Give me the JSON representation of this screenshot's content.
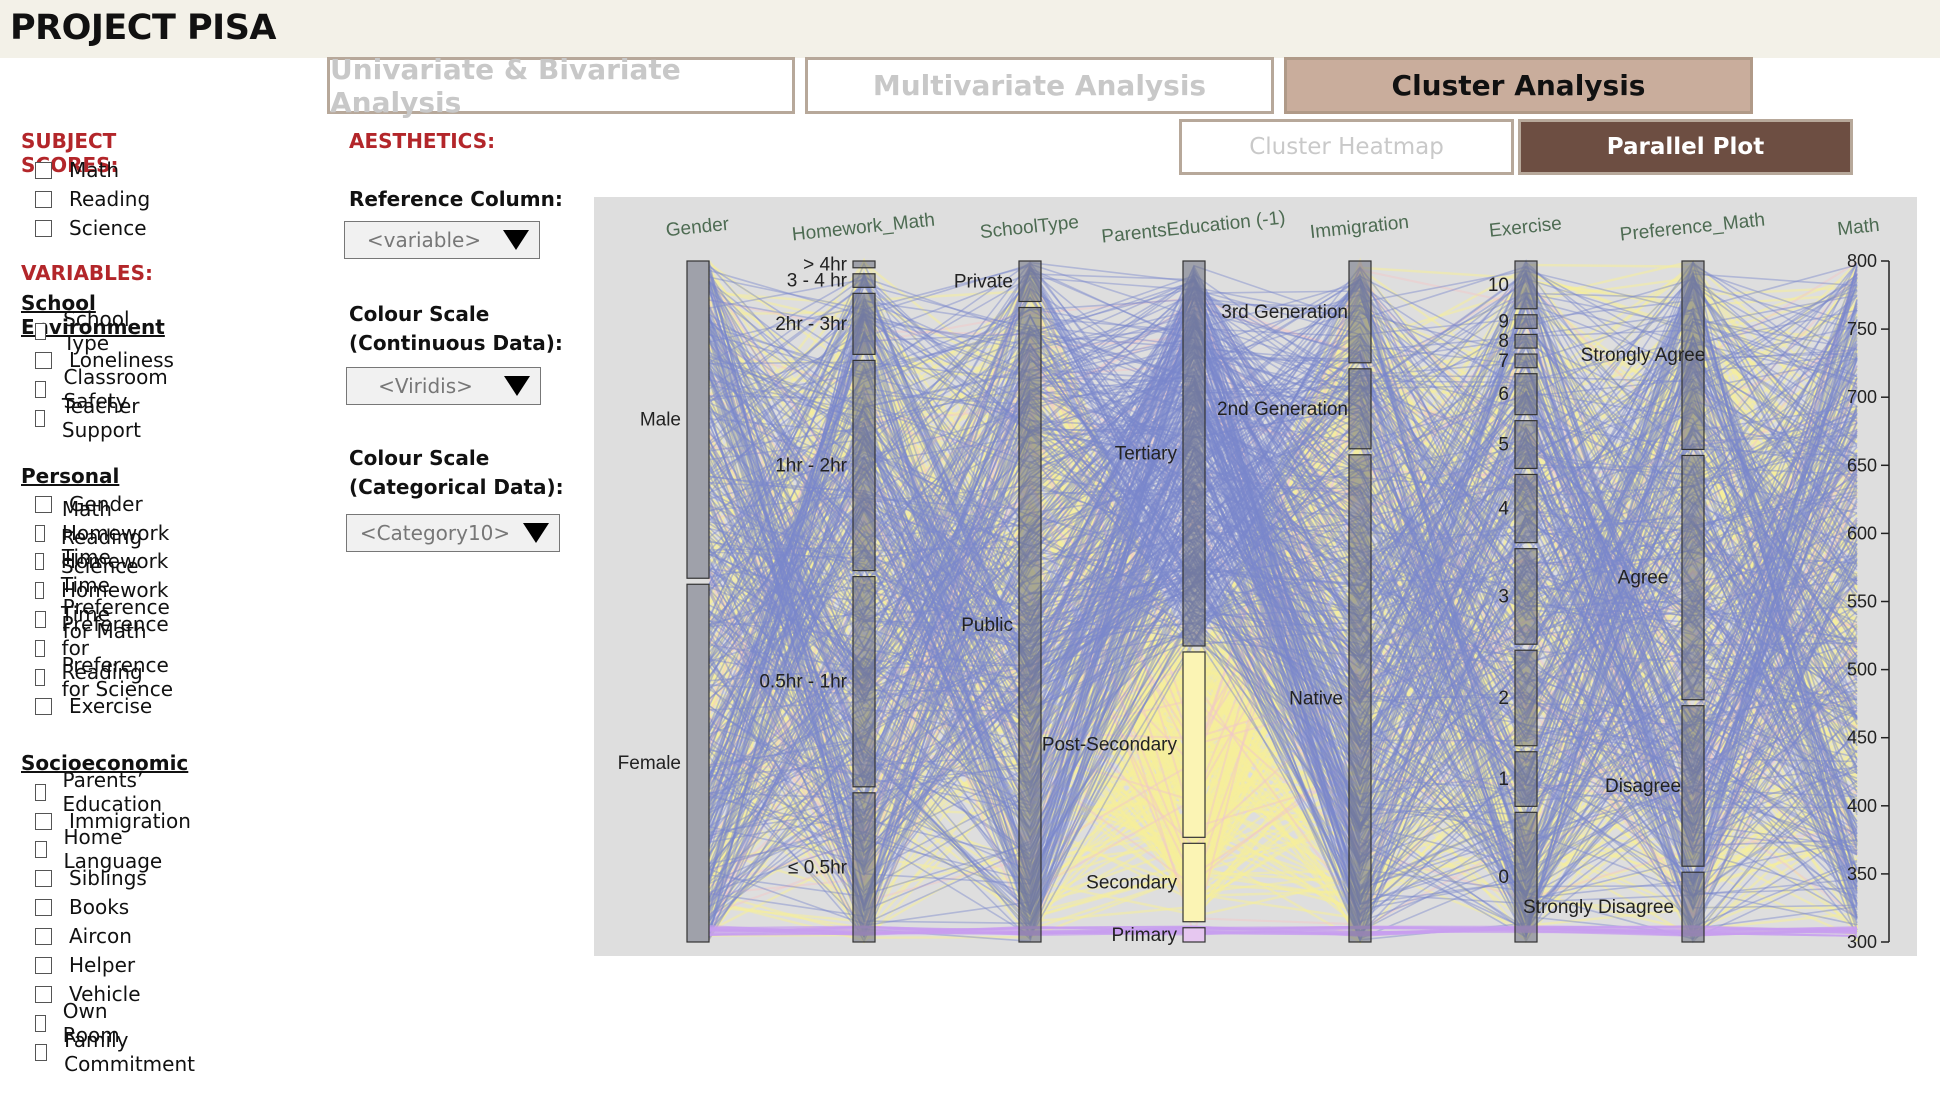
{
  "app": {
    "title": "PROJECT PISA"
  },
  "tabs": [
    {
      "label": "Univariate & Bivariate Analysis",
      "active": false
    },
    {
      "label": "Multivariate Analysis",
      "active": false
    },
    {
      "label": "Cluster Analysis",
      "active": true
    }
  ],
  "subtabs": [
    {
      "label": "Cluster Heatmap",
      "active": false
    },
    {
      "label": "Parallel Plot",
      "active": true
    }
  ],
  "sidebar": {
    "subject_scores_title": "SUBJECT SCORES:",
    "subject_scores": [
      "Math",
      "Reading",
      "Science"
    ],
    "variables_title": "VARIABLES:",
    "groups": [
      {
        "title": "School Environment",
        "items": [
          "School Type",
          "Loneliness",
          "Classroom Safety",
          "Teacher Support"
        ]
      },
      {
        "title": "Personal",
        "items": [
          "Gender",
          "Math Homework Time",
          "Reading Homework Time",
          "Science Homework Time",
          "Preference for Math",
          "Preference for Reading",
          "Preference for Science",
          "Exercise"
        ]
      },
      {
        "title": "Socioeconomic",
        "items": [
          "Parents’ Education",
          "Immigration",
          "Home Language",
          "Siblings",
          "Books",
          "Aircon",
          "Helper",
          "Vehicle",
          "Own Room",
          "Family Commitment"
        ]
      }
    ]
  },
  "aesthetics": {
    "title": "AESTHETICS:",
    "reference_label": "Reference Column:",
    "reference_value": "<variable>",
    "continuous_label_1": "Colour Scale",
    "continuous_label_2": "(Continuous Data):",
    "continuous_value": "<Viridis>",
    "categorical_label_1": "Colour Scale",
    "categorical_label_2": "(Categorical Data):",
    "categorical_value": "<Category10>"
  },
  "colors": {
    "blue_cluster": "#7b88cc",
    "yellow_cluster": "#f6ef9a",
    "pink_cluster": "#f2c7c7",
    "purple_cluster": "#c89ef0",
    "accent_red": "#b3262a",
    "tab_active": "#c9ad9c",
    "subtab_active": "#6d4e42"
  },
  "chart_data": {
    "type": "parallel-categories",
    "axes": [
      {
        "name": "Gender",
        "categories": [
          {
            "label": "Male",
            "share": 0.47
          },
          {
            "label": "Female",
            "share": 0.53
          }
        ]
      },
      {
        "name": "Homework_Math",
        "categories": [
          {
            "label": "> 4hr",
            "share": 0.01
          },
          {
            "label": "3 - 4 hr",
            "share": 0.02
          },
          {
            "label": "2hr - 3hr",
            "share": 0.09
          },
          {
            "label": "1hr - 2hr",
            "share": 0.31
          },
          {
            "label": "0.5hr - 1hr",
            "share": 0.31
          },
          {
            "label": "≤ 0.5hr",
            "share": 0.22
          }
        ]
      },
      {
        "name": "SchoolType",
        "categories": [
          {
            "label": "Private",
            "share": 0.06
          },
          {
            "label": "Public",
            "share": 0.94
          }
        ]
      },
      {
        "name": "ParentsEducation (-1)",
        "categories": [
          {
            "label": "Tertiary",
            "share": 0.54
          },
          {
            "label": "Post-Secondary",
            "share": 0.26
          },
          {
            "label": "Secondary",
            "share": 0.11
          },
          {
            "label": "Primary",
            "share": 0.02
          }
        ]
      },
      {
        "name": "Immigration",
        "categories": [
          {
            "label": "3rd Generation",
            "share": 0.14
          },
          {
            "label": "2nd Generation",
            "share": 0.11
          },
          {
            "label": "Native",
            "share": 0.67
          }
        ]
      },
      {
        "name": "Exercise",
        "categories": [
          {
            "label": "10",
            "share": 0.07
          },
          {
            "label": "9",
            "share": 0.02
          },
          {
            "label": "8",
            "share": 0.02
          },
          {
            "label": "7",
            "share": 0.02
          },
          {
            "label": "6",
            "share": 0.06
          },
          {
            "label": "5",
            "share": 0.07
          },
          {
            "label": "4",
            "share": 0.1
          },
          {
            "label": "3",
            "share": 0.14
          },
          {
            "label": "2",
            "share": 0.14
          },
          {
            "label": "1",
            "share": 0.08
          },
          {
            "label": "0",
            "share": 0.19
          }
        ]
      },
      {
        "name": "Preference_Math",
        "categories": [
          {
            "label": "Strongly Agree",
            "share": 0.27
          },
          {
            "label": "Agree",
            "share": 0.35
          },
          {
            "label": "Disagree",
            "share": 0.23
          },
          {
            "label": "Strongly Disagree",
            "share": 0.1
          }
        ]
      },
      {
        "name": "Math",
        "continuous": true,
        "ticks": [
          "800",
          "750",
          "700",
          "650",
          "600",
          "550",
          "500",
          "450",
          "400",
          "350",
          "300"
        ],
        "range": [
          300,
          800
        ]
      }
    ],
    "clusters": [
      "blue",
      "yellow",
      "pink",
      "purple"
    ]
  }
}
